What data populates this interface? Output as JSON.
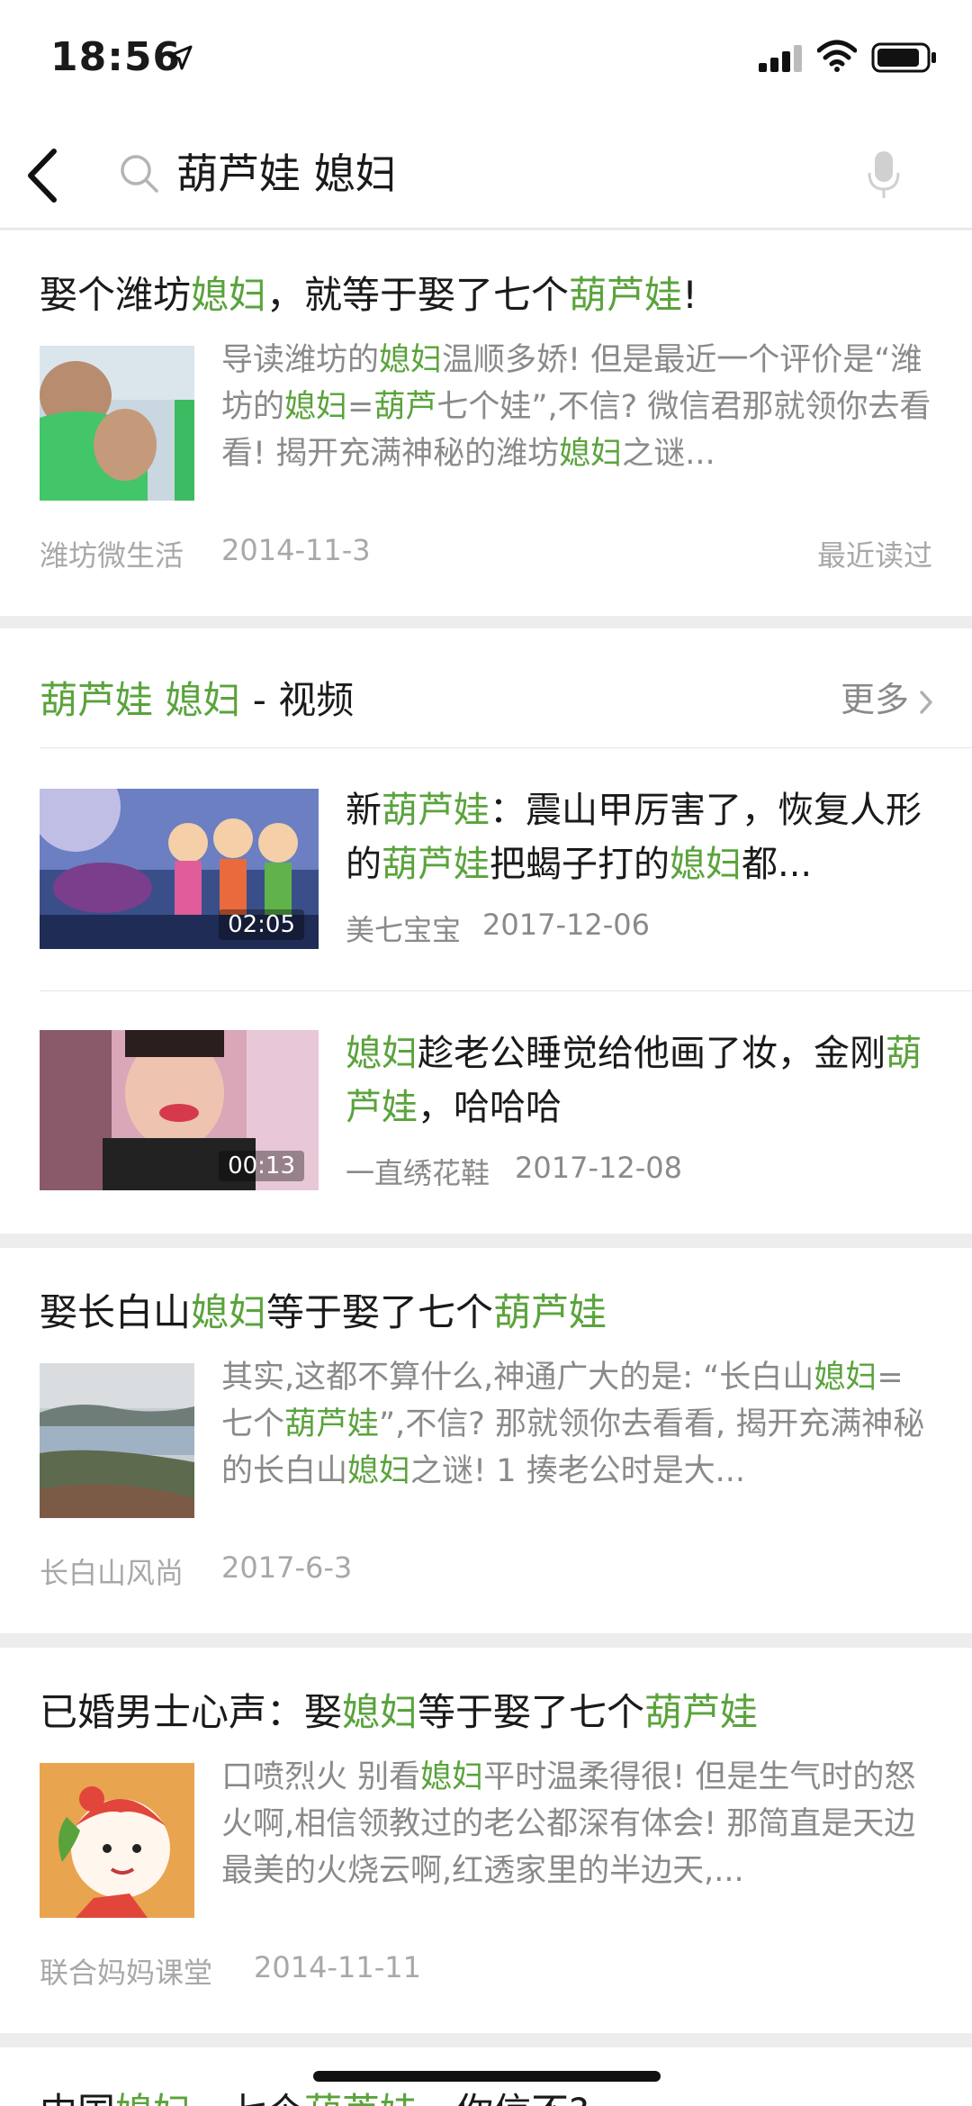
{
  "status_bar": {
    "time": "18:56"
  },
  "search": {
    "query": "葫芦娃 媳妇"
  },
  "results": [
    {
      "title_parts": [
        {
          "t": "娶个潍坊",
          "hl": false
        },
        {
          "t": "媳妇",
          "hl": true
        },
        {
          "t": "，就等于娶了七个",
          "hl": false
        },
        {
          "t": "葫芦娃",
          "hl": true
        },
        {
          "t": "!",
          "hl": false
        }
      ],
      "snippet_parts": [
        {
          "t": "导读潍坊的",
          "hl": false
        },
        {
          "t": "媳妇",
          "hl": true
        },
        {
          "t": "温顺多娇! 但是最近一个评价是“潍坊的",
          "hl": false
        },
        {
          "t": "媳妇",
          "hl": true
        },
        {
          "t": "=",
          "hl": false
        },
        {
          "t": "葫芦",
          "hl": true
        },
        {
          "t": "七个娃”,不信? 微信君那就领你去看看! 揭开充满神秘的潍坊",
          "hl": false
        },
        {
          "t": "媳妇",
          "hl": true
        },
        {
          "t": "之谜...",
          "hl": false
        }
      ],
      "source": "潍坊微生活",
      "date": "2014-11-3",
      "recent": "最近读过"
    },
    {
      "title_parts": [
        {
          "t": "娶长白山",
          "hl": false
        },
        {
          "t": "媳妇",
          "hl": true
        },
        {
          "t": "等于娶了七个",
          "hl": false
        },
        {
          "t": "葫芦娃",
          "hl": true
        }
      ],
      "snippet_parts": [
        {
          "t": "其实,这都不算什么,神通广大的是: “长白山",
          "hl": false
        },
        {
          "t": "媳妇",
          "hl": true
        },
        {
          "t": "=七个",
          "hl": false
        },
        {
          "t": "葫芦娃",
          "hl": true
        },
        {
          "t": "”,不信? 那就领你去看看, 揭开充满神秘的长白山",
          "hl": false
        },
        {
          "t": "媳妇",
          "hl": true
        },
        {
          "t": "之谜! 1 揍老公时是大...",
          "hl": false
        }
      ],
      "source": "长白山风尚",
      "date": "2017-6-3"
    },
    {
      "title_parts": [
        {
          "t": "已婚男士心声：娶",
          "hl": false
        },
        {
          "t": "媳妇",
          "hl": true
        },
        {
          "t": "等于娶了七个",
          "hl": false
        },
        {
          "t": "葫芦娃",
          "hl": true
        }
      ],
      "snippet_parts": [
        {
          "t": "口喷烈火 别看",
          "hl": false
        },
        {
          "t": "媳妇",
          "hl": true
        },
        {
          "t": "平时温柔得很! 但是生气时的怒火啊,相信领教过的老公都深有体会! 那简直是天边最美的火烧云啊,红透家里的半边天,...",
          "hl": false
        }
      ],
      "source": "联合妈妈课堂",
      "date": "2014-11-11"
    },
    {
      "title_parts": [
        {
          "t": "中国",
          "hl": false
        },
        {
          "t": "媳妇",
          "hl": true
        },
        {
          "t": "、七个",
          "hl": false
        },
        {
          "t": "葫芦娃",
          "hl": true
        },
        {
          "t": "，你信不?",
          "hl": false
        }
      ]
    }
  ],
  "video_section": {
    "title_parts": [
      {
        "t": "葫芦娃 媳妇",
        "hl": true
      },
      {
        "t": " - 视频",
        "hl": false
      }
    ],
    "more_label": "更多",
    "videos": [
      {
        "duration": "02:05",
        "title_parts": [
          {
            "t": "新",
            "hl": false
          },
          {
            "t": "葫芦娃",
            "hl": true
          },
          {
            "t": "：震山甲厉害了，恢复人形的",
            "hl": false
          },
          {
            "t": "葫芦娃",
            "hl": true
          },
          {
            "t": "把蝎子打的",
            "hl": false
          },
          {
            "t": "媳妇",
            "hl": true
          },
          {
            "t": "都...",
            "hl": false
          }
        ],
        "author": "美七宝宝",
        "date": "2017-12-06"
      },
      {
        "duration": "00:13",
        "title_parts": [
          {
            "t": "媳妇",
            "hl": true
          },
          {
            "t": "趁老公睡觉给他画了妆，金刚",
            "hl": false
          },
          {
            "t": "葫芦娃",
            "hl": true
          },
          {
            "t": "，哈哈哈",
            "hl": false
          }
        ],
        "author": "一直绣花鞋",
        "date": "2017-12-08"
      }
    ]
  },
  "colors": {
    "highlight": "#5aa33c",
    "background": "#ededed",
    "meta": "#a8a8a8"
  }
}
